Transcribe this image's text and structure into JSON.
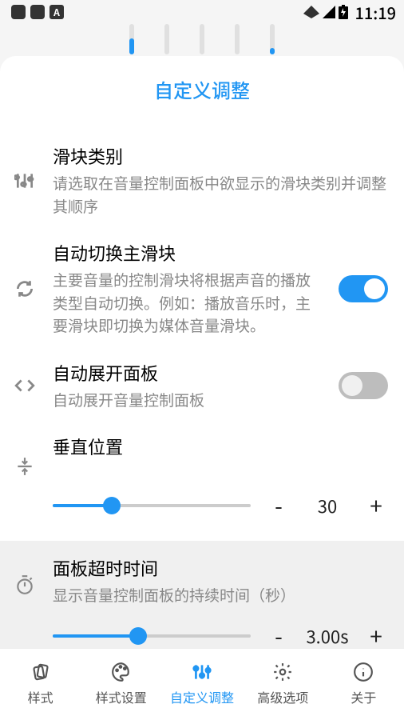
{
  "status": {
    "time": "11:19"
  },
  "panel": {
    "title": "自定义调整"
  },
  "settings": {
    "sliderCategory": {
      "title": "滑块类别",
      "desc": "请选取在音量控制面板中欲显示的滑块类别并调整其顺序"
    },
    "autoSwitch": {
      "title": "自动切换主滑块",
      "desc": "主要音量的控制滑块将根据声音的播放类型自动切换。例如：播放音乐时，主要滑块即切换为媒体音量滑块。"
    },
    "autoExpand": {
      "title": "自动展开面板",
      "desc": "自动展开音量控制面板"
    },
    "verticalPosition": {
      "title": "垂直位置",
      "value": "30",
      "minus": "-",
      "plus": "+"
    },
    "timeout": {
      "title": "面板超时时间",
      "desc": "显示音量控制面板的持续时间（秒）",
      "value": "3.00s",
      "minus": "-",
      "plus": "+"
    }
  },
  "nav": {
    "items": [
      {
        "label": "样式"
      },
      {
        "label": "样式设置"
      },
      {
        "label": "自定义调整"
      },
      {
        "label": "高级选项"
      },
      {
        "label": "关于"
      }
    ]
  }
}
